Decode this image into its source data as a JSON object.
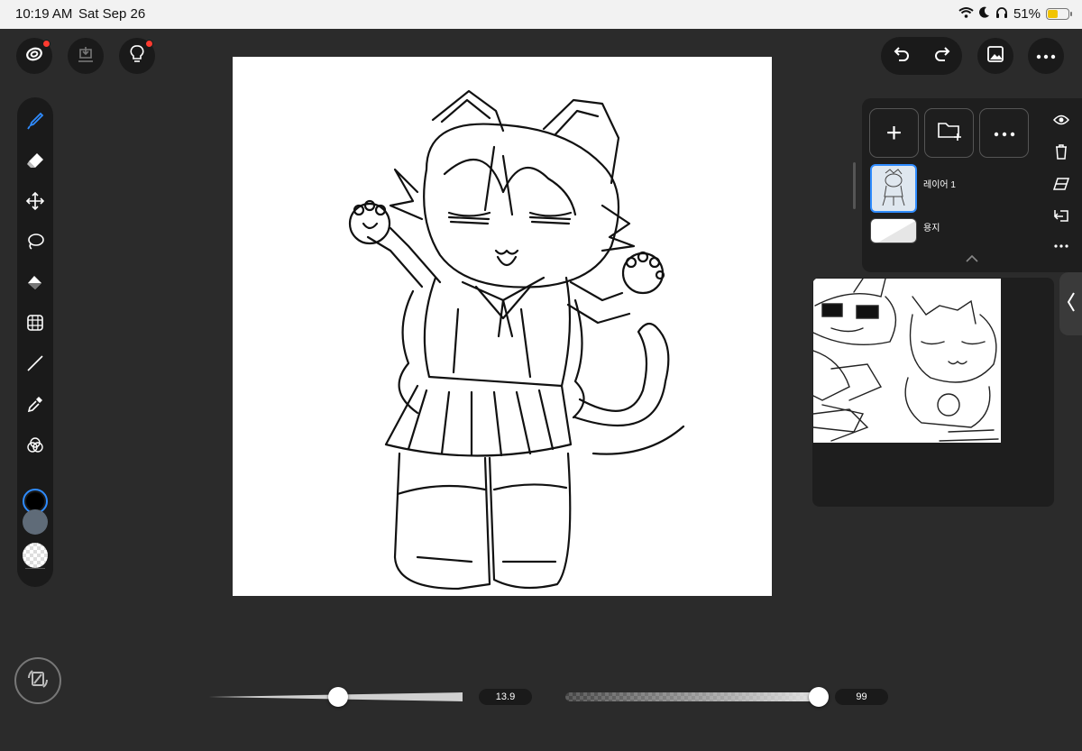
{
  "status_bar": {
    "time": "10:19 AM",
    "date": "Sat Sep 26",
    "battery": "51%"
  },
  "top_left_buttons": [
    {
      "icon": "app-logo-icon",
      "badge": true
    },
    {
      "icon": "download-icon",
      "badge": false
    },
    {
      "icon": "lightbulb-icon",
      "badge": true
    }
  ],
  "top_right": {
    "undo_icon": "undo-icon",
    "redo_icon": "redo-icon",
    "gallery_icon": "image-icon",
    "more_icon": "more-icon"
  },
  "toolbar": {
    "tools": [
      "brush-icon",
      "eraser-icon",
      "move-icon",
      "lasso-icon",
      "fill-icon",
      "transform-grid-icon",
      "line-icon",
      "eyedropper-icon",
      "color-blend-icon"
    ],
    "active_tool": "brush-icon",
    "colors": {
      "primary": "#000000",
      "secondary": "#5f6b78"
    },
    "accent": "#2f8cff"
  },
  "layers": {
    "add_label": "+",
    "items": [
      {
        "name": "레이어 1",
        "selected": true
      },
      {
        "name": "용지",
        "selected": false
      }
    ]
  },
  "layer_side_icons": [
    "eye-icon",
    "trash-icon",
    "eraser-layer-icon",
    "merge-down-icon",
    "more-icon"
  ],
  "sliders": {
    "size_value": "13.9",
    "size_fraction": 0.51,
    "opacity_value": "99",
    "opacity_fraction": 0.99
  }
}
